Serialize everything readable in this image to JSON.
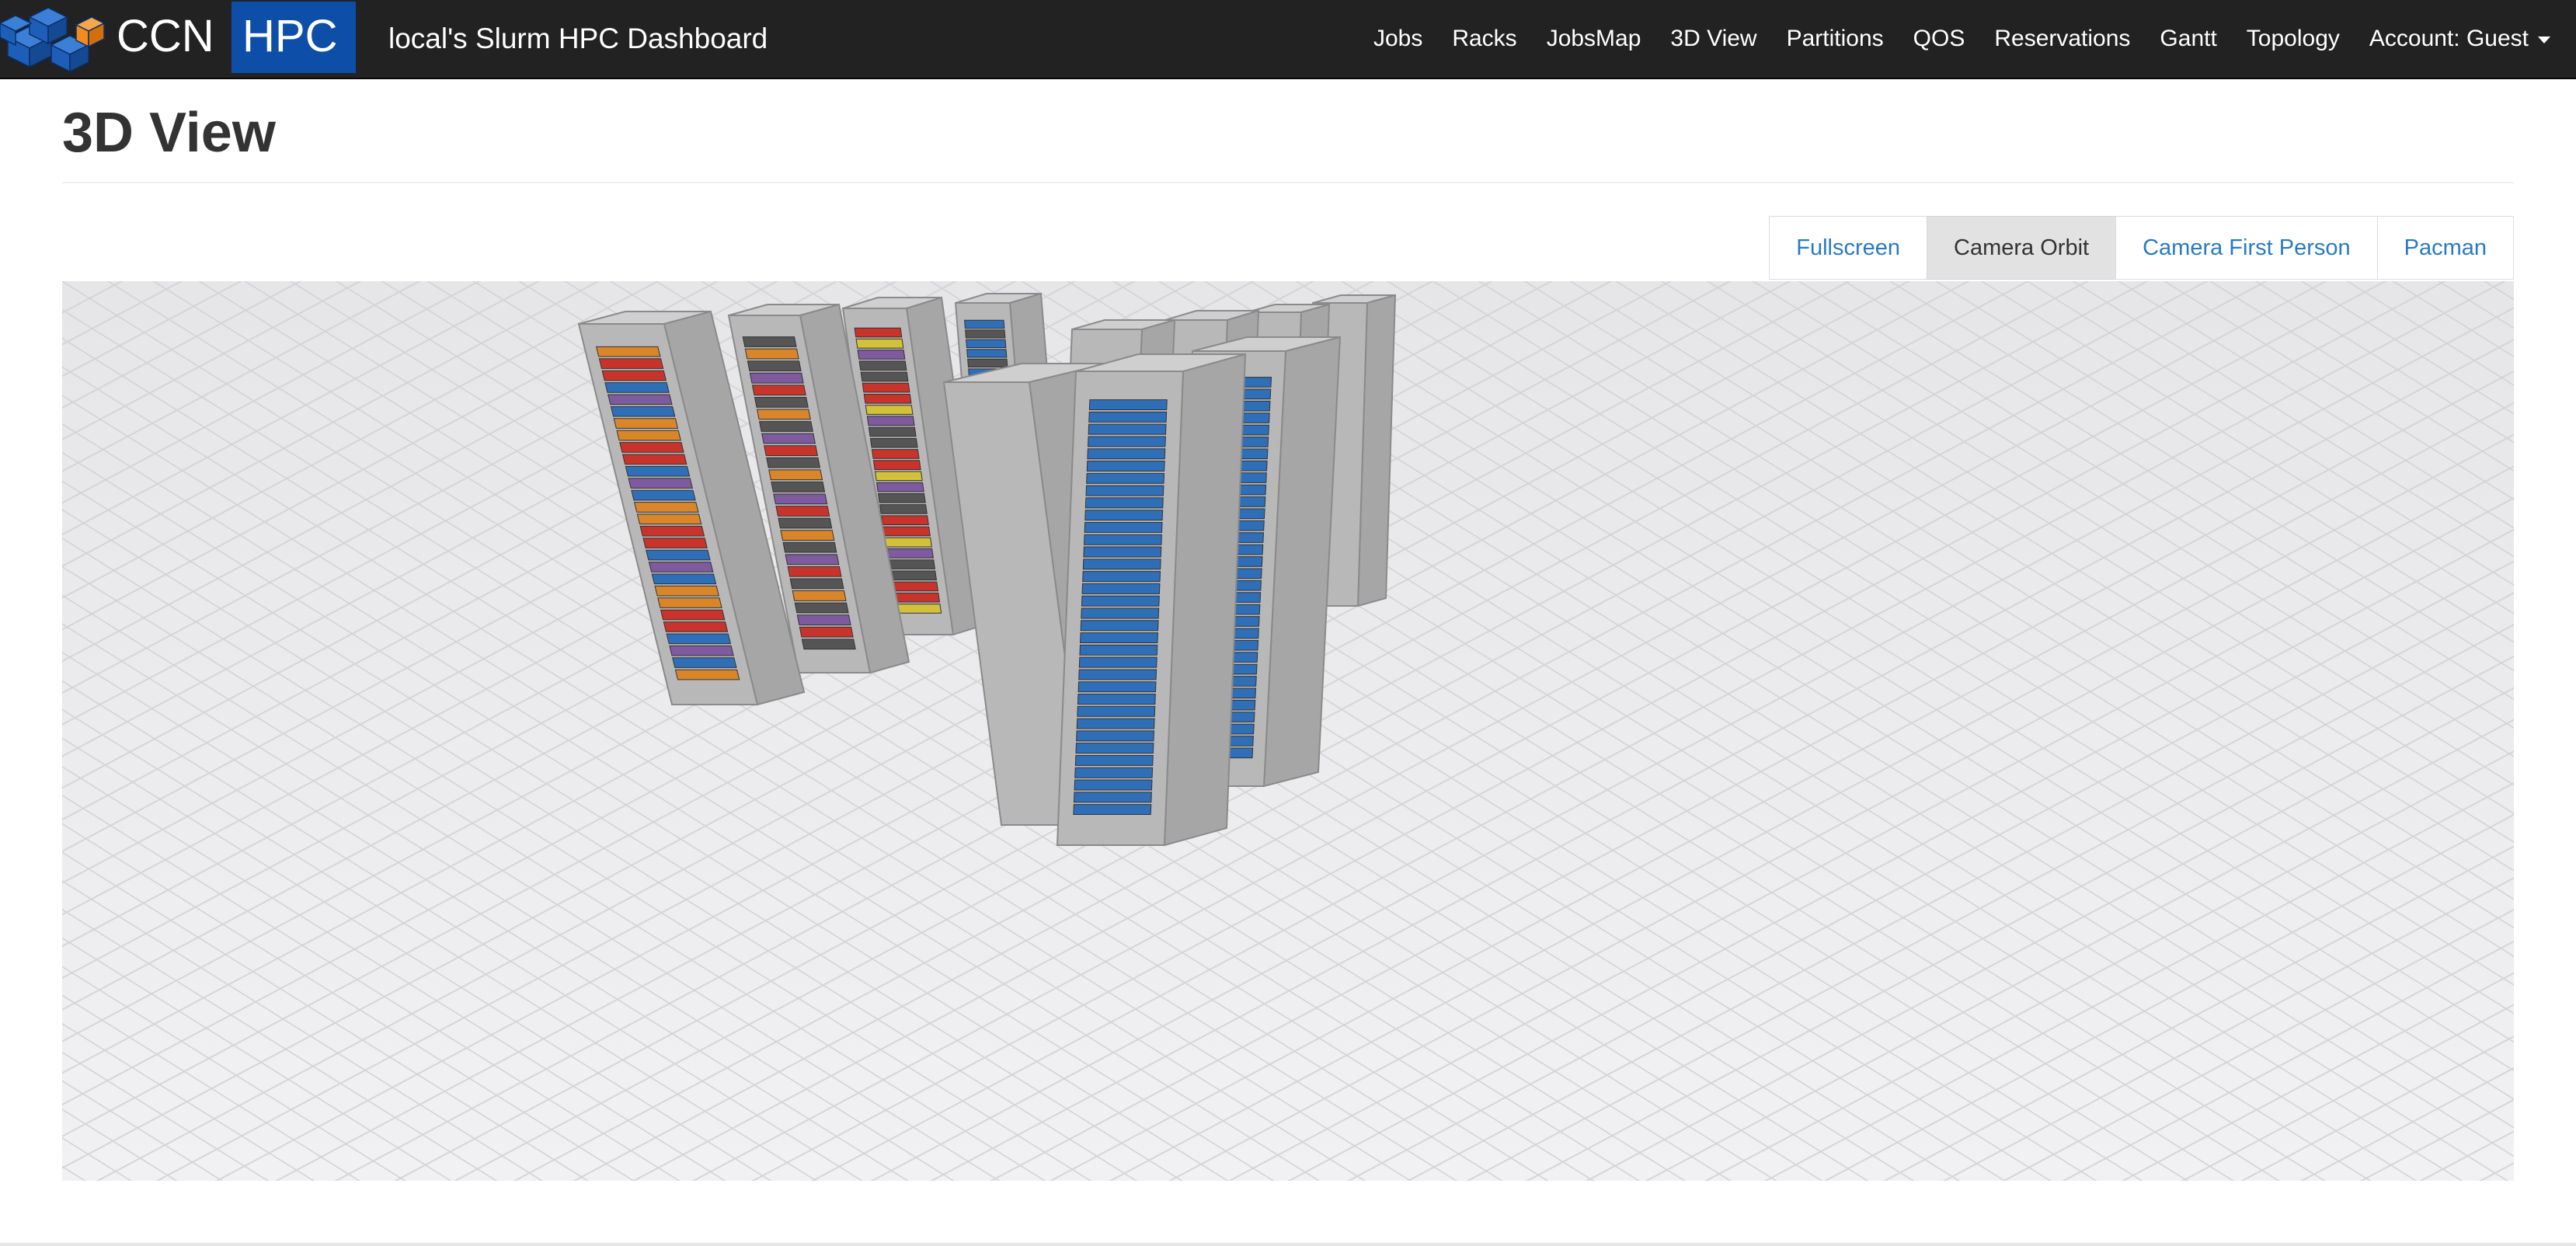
{
  "brand": {
    "logo_text_left": "CCN",
    "logo_text_right": "HPC",
    "title": "local's Slurm HPC Dashboard",
    "colors": {
      "navbar": "#222222",
      "logo_blue": "#0d4fa8",
      "logo_orange": "#f28a1c"
    }
  },
  "nav": {
    "items": [
      "Jobs",
      "Racks",
      "JobsMap",
      "3D View",
      "Partitions",
      "QOS",
      "Reservations",
      "Gantt",
      "Topology"
    ],
    "account": "Account: Guest"
  },
  "page": {
    "title": "3D View"
  },
  "toolbar": {
    "buttons": [
      {
        "label": "Fullscreen",
        "active": false
      },
      {
        "label": "Camera Orbit",
        "active": true
      },
      {
        "label": "Camera First Person",
        "active": false
      },
      {
        "label": "Pacman",
        "active": false
      }
    ],
    "colors": {
      "link": "#2a7ac2",
      "active_bg": "#e2e2e2"
    }
  },
  "scene": {
    "description_icon": "3d-rack-scene",
    "rack_count": 9,
    "colors": {
      "floor": "#eeeef0",
      "rack": "#b8b8b8",
      "node_blue": "#2f6fb8",
      "node_red": "#c8342c",
      "node_orange": "#d9862a",
      "node_purple": "#7e5a9e",
      "node_yellow": "#d4c13a",
      "node_gray": "#555555"
    }
  }
}
